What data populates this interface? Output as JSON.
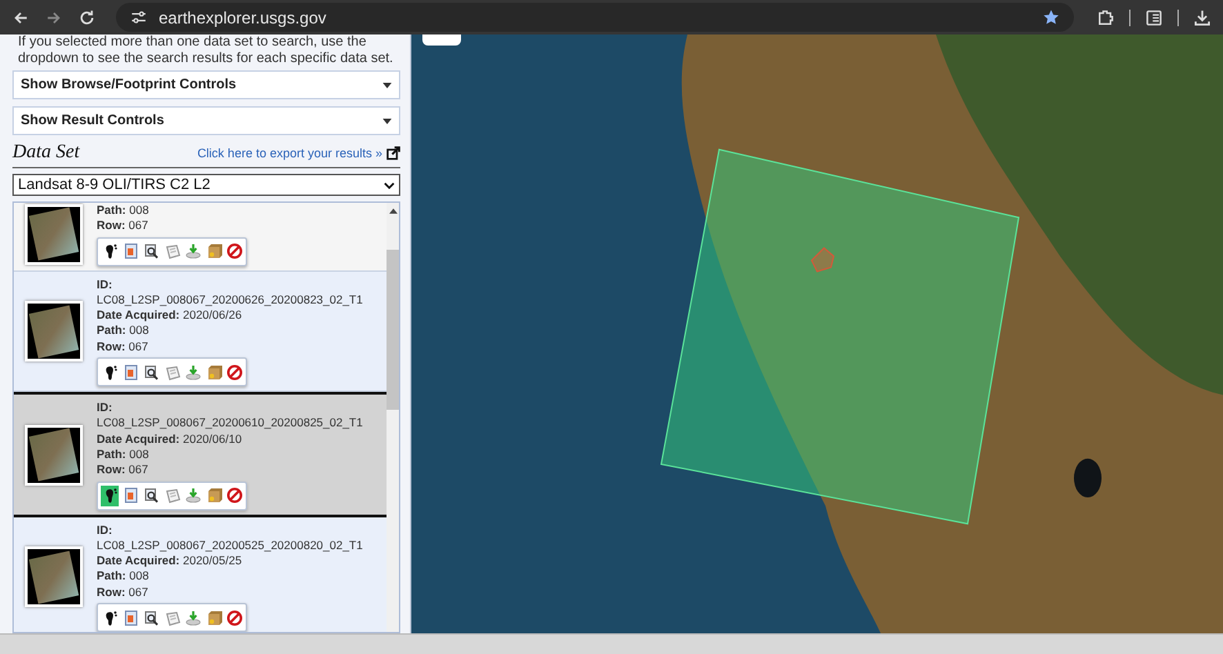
{
  "browser": {
    "url": "earthexplorer.usgs.gov"
  },
  "panel": {
    "intro": "If you selected more than one data set to search, use the dropdown to see the search results for each specific data set.",
    "toggles": [
      "Show Browse/Footprint Controls",
      "Show Result Controls"
    ],
    "dataset_heading": "Data Set",
    "export_link": "Click here to export your results »",
    "dataset_select": {
      "value": "Landsat 8-9 OLI/TIRS C2 L2"
    },
    "results": [
      {
        "selected": false,
        "footprint_on": false,
        "fields": [
          {
            "label": "Path:",
            "value": "008"
          },
          {
            "label": "Row:",
            "value": "067"
          }
        ]
      },
      {
        "selected": false,
        "footprint_on": false,
        "id_label": "ID:",
        "id": "LC08_L2SP_008067_20200626_20200823_02_T1",
        "fields": [
          {
            "label": "Date Acquired:",
            "value": "2020/06/26"
          },
          {
            "label": "Path:",
            "value": "008"
          },
          {
            "label": "Row:",
            "value": "067"
          }
        ]
      },
      {
        "selected": true,
        "footprint_on": true,
        "id_label": "ID:",
        "id": "LC08_L2SP_008067_20200610_20200825_02_T1",
        "fields": [
          {
            "label": "Date Acquired:",
            "value": "2020/06/10"
          },
          {
            "label": "Path:",
            "value": "008"
          },
          {
            "label": "Row:",
            "value": "067"
          }
        ]
      },
      {
        "selected": false,
        "footprint_on": false,
        "id_label": "ID:",
        "id": "LC08_L2SP_008067_20200525_20200820_02_T1",
        "fields": [
          {
            "label": "Date Acquired:",
            "value": "2020/05/25"
          },
          {
            "label": "Path:",
            "value": "008"
          },
          {
            "label": "Row:",
            "value": "067"
          }
        ]
      }
    ]
  }
}
